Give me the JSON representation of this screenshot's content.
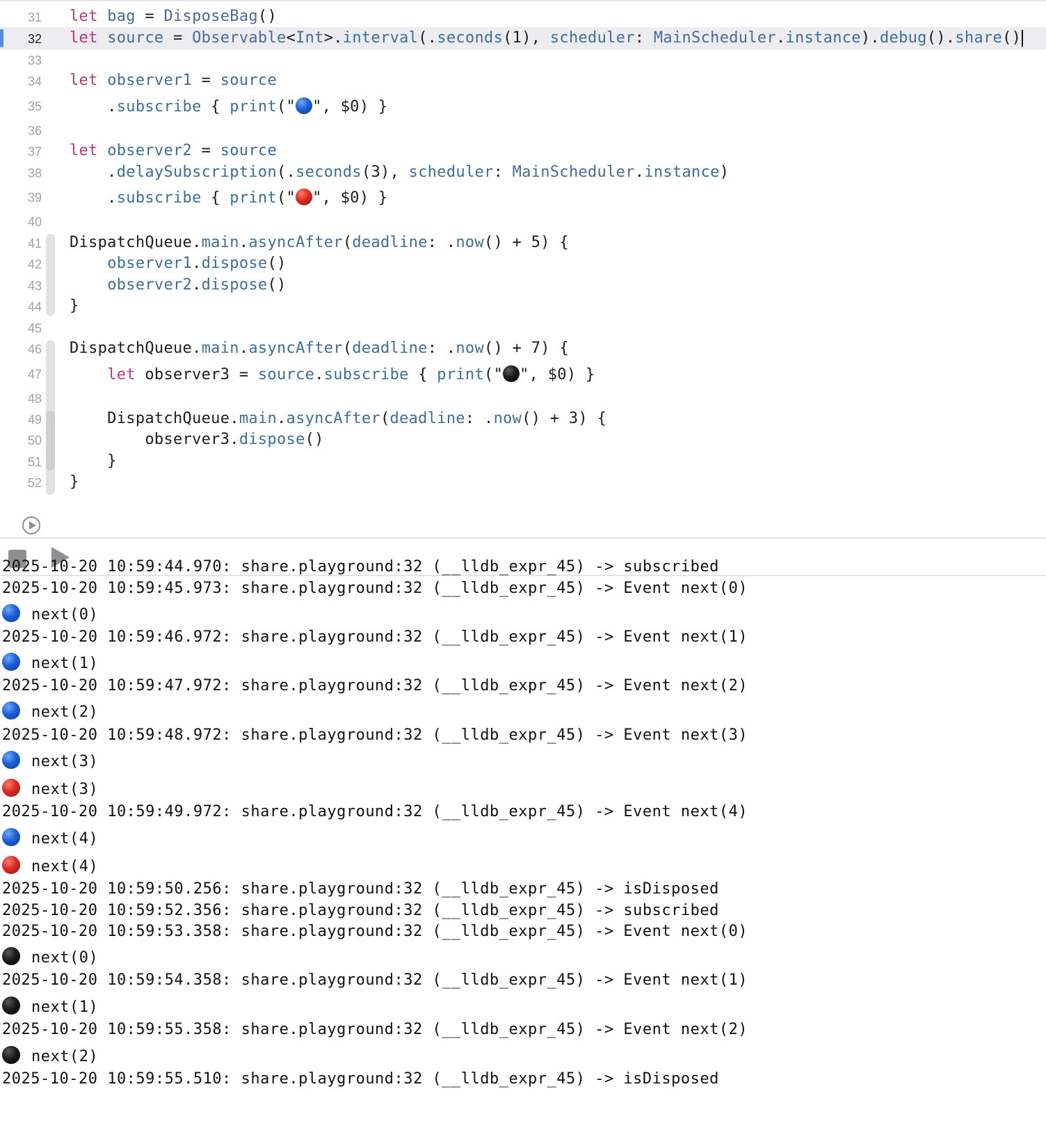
{
  "editor": {
    "lines": [
      {
        "n": "31",
        "parts": [
          [
            "kw",
            "let "
          ],
          [
            "id",
            "bag"
          ],
          [
            "punc",
            " = "
          ],
          [
            "ty",
            "DisposeBag"
          ],
          [
            "punc",
            "()"
          ]
        ]
      },
      {
        "n": "32",
        "current": true,
        "parts": [
          [
            "kw",
            "let "
          ],
          [
            "id",
            "source"
          ],
          [
            "punc",
            " = "
          ],
          [
            "ty",
            "Observable"
          ],
          [
            "punc",
            "<"
          ],
          [
            "ty",
            "Int"
          ],
          [
            "punc",
            ">."
          ],
          [
            "id",
            "interval"
          ],
          [
            "punc",
            "(."
          ],
          [
            "id",
            "seconds"
          ],
          [
            "punc",
            "(1), "
          ],
          [
            "id",
            "scheduler"
          ],
          [
            "punc",
            ": "
          ],
          [
            "ty",
            "MainScheduler"
          ],
          [
            "punc",
            "."
          ],
          [
            "id",
            "instance"
          ],
          [
            "punc",
            ")."
          ],
          [
            "id",
            "debug"
          ],
          [
            "punc",
            "()."
          ],
          [
            "id",
            "share"
          ],
          [
            "punc",
            "()"
          ]
        ]
      },
      {
        "n": "33",
        "parts": []
      },
      {
        "n": "34",
        "parts": [
          [
            "kw",
            "let "
          ],
          [
            "id",
            "observer1"
          ],
          [
            "punc",
            " = "
          ],
          [
            "id",
            "source"
          ]
        ]
      },
      {
        "n": "35",
        "parts": [
          [
            "punc",
            "    ."
          ],
          [
            "id",
            "subscribe"
          ],
          [
            "punc",
            " { "
          ],
          [
            "id",
            "print"
          ],
          [
            "punc",
            "(\""
          ],
          [
            "ball",
            "blue"
          ],
          [
            "punc",
            "\", $0) }"
          ]
        ]
      },
      {
        "n": "36",
        "parts": []
      },
      {
        "n": "37",
        "parts": [
          [
            "kw",
            "let "
          ],
          [
            "id",
            "observer2"
          ],
          [
            "punc",
            " = "
          ],
          [
            "id",
            "source"
          ]
        ]
      },
      {
        "n": "38",
        "parts": [
          [
            "punc",
            "    ."
          ],
          [
            "id",
            "delaySubscription"
          ],
          [
            "punc",
            "(."
          ],
          [
            "id",
            "seconds"
          ],
          [
            "punc",
            "(3), "
          ],
          [
            "id",
            "scheduler"
          ],
          [
            "punc",
            ": "
          ],
          [
            "ty",
            "MainScheduler"
          ],
          [
            "punc",
            "."
          ],
          [
            "id",
            "instance"
          ],
          [
            "punc",
            ")"
          ]
        ]
      },
      {
        "n": "39",
        "parts": [
          [
            "punc",
            "    ."
          ],
          [
            "id",
            "subscribe"
          ],
          [
            "punc",
            " { "
          ],
          [
            "id",
            "print"
          ],
          [
            "punc",
            "(\""
          ],
          [
            "ball",
            "red"
          ],
          [
            "punc",
            "\", $0) }"
          ]
        ]
      },
      {
        "n": "40",
        "parts": []
      },
      {
        "n": "41",
        "parts": [
          [
            "punc",
            "DispatchQueue."
          ],
          [
            "id",
            "main"
          ],
          [
            "punc",
            "."
          ],
          [
            "id",
            "asyncAfter"
          ],
          [
            "punc",
            "("
          ],
          [
            "id",
            "deadline"
          ],
          [
            "punc",
            ": ."
          ],
          [
            "id",
            "now"
          ],
          [
            "punc",
            "() + 5) {"
          ]
        ]
      },
      {
        "n": "42",
        "parts": [
          [
            "punc",
            "    "
          ],
          [
            "id",
            "observer1"
          ],
          [
            "punc",
            "."
          ],
          [
            "id",
            "dispose"
          ],
          [
            "punc",
            "()"
          ]
        ]
      },
      {
        "n": "43",
        "parts": [
          [
            "punc",
            "    "
          ],
          [
            "id",
            "observer2"
          ],
          [
            "punc",
            "."
          ],
          [
            "id",
            "dispose"
          ],
          [
            "punc",
            "()"
          ]
        ]
      },
      {
        "n": "44",
        "parts": [
          [
            "punc",
            "}"
          ]
        ]
      },
      {
        "n": "45",
        "parts": []
      },
      {
        "n": "46",
        "parts": [
          [
            "punc",
            "DispatchQueue."
          ],
          [
            "id",
            "main"
          ],
          [
            "punc",
            "."
          ],
          [
            "id",
            "asyncAfter"
          ],
          [
            "punc",
            "("
          ],
          [
            "id",
            "deadline"
          ],
          [
            "punc",
            ": ."
          ],
          [
            "id",
            "now"
          ],
          [
            "punc",
            "() + 7) {"
          ]
        ]
      },
      {
        "n": "47",
        "parts": [
          [
            "punc",
            "    "
          ],
          [
            "kw",
            "let "
          ],
          [
            "punc",
            "observer3 = "
          ],
          [
            "id",
            "source"
          ],
          [
            "punc",
            "."
          ],
          [
            "id",
            "subscribe"
          ],
          [
            "punc",
            " { "
          ],
          [
            "id",
            "print"
          ],
          [
            "punc",
            "(\""
          ],
          [
            "ball",
            "black"
          ],
          [
            "punc",
            "\", $0) }"
          ]
        ]
      },
      {
        "n": "48",
        "parts": []
      },
      {
        "n": "49",
        "parts": [
          [
            "punc",
            "    DispatchQueue."
          ],
          [
            "id",
            "main"
          ],
          [
            "punc",
            "."
          ],
          [
            "id",
            "asyncAfter"
          ],
          [
            "punc",
            "("
          ],
          [
            "id",
            "deadline"
          ],
          [
            "punc",
            ": ."
          ],
          [
            "id",
            "now"
          ],
          [
            "punc",
            "() + 3) {"
          ]
        ]
      },
      {
        "n": "50",
        "parts": [
          [
            "punc",
            "        observer3."
          ],
          [
            "id",
            "dispose"
          ],
          [
            "punc",
            "()"
          ]
        ]
      },
      {
        "n": "51",
        "parts": [
          [
            "punc",
            "    }"
          ]
        ]
      },
      {
        "n": "52",
        "parts": [
          [
            "punc",
            "}"
          ]
        ]
      }
    ]
  },
  "toolbar": {
    "stop_icon": "stop-icon",
    "play_icon": "play-icon"
  },
  "console": {
    "lines": [
      {
        "text": "2025-10-20 10:59:44.970: share.playground:32 (__lldb_expr_45) -> subscribed"
      },
      {
        "text": "2025-10-20 10:59:45.973: share.playground:32 (__lldb_expr_45) -> Event next(0)"
      },
      {
        "ball": "blue",
        "text": "next(0)"
      },
      {
        "text": "2025-10-20 10:59:46.972: share.playground:32 (__lldb_expr_45) -> Event next(1)"
      },
      {
        "ball": "blue",
        "text": "next(1)"
      },
      {
        "text": "2025-10-20 10:59:47.972: share.playground:32 (__lldb_expr_45) -> Event next(2)"
      },
      {
        "ball": "blue",
        "text": "next(2)"
      },
      {
        "text": "2025-10-20 10:59:48.972: share.playground:32 (__lldb_expr_45) -> Event next(3)"
      },
      {
        "ball": "blue",
        "text": "next(3)"
      },
      {
        "ball": "red",
        "text": "next(3)"
      },
      {
        "text": "2025-10-20 10:59:49.972: share.playground:32 (__lldb_expr_45) -> Event next(4)"
      },
      {
        "ball": "blue",
        "text": "next(4)"
      },
      {
        "ball": "red",
        "text": "next(4)"
      },
      {
        "text": "2025-10-20 10:59:50.256: share.playground:32 (__lldb_expr_45) -> isDisposed"
      },
      {
        "text": "2025-10-20 10:59:52.356: share.playground:32 (__lldb_expr_45) -> subscribed"
      },
      {
        "text": "2025-10-20 10:59:53.358: share.playground:32 (__lldb_expr_45) -> Event next(0)"
      },
      {
        "ball": "black",
        "text": "next(0)"
      },
      {
        "text": "2025-10-20 10:59:54.358: share.playground:32 (__lldb_expr_45) -> Event next(1)"
      },
      {
        "ball": "black",
        "text": "next(1)"
      },
      {
        "text": "2025-10-20 10:59:55.358: share.playground:32 (__lldb_expr_45) -> Event next(2)"
      },
      {
        "ball": "black",
        "text": "next(2)"
      },
      {
        "text": "2025-10-20 10:59:55.510: share.playground:32 (__lldb_expr_45) -> isDisposed"
      }
    ]
  }
}
